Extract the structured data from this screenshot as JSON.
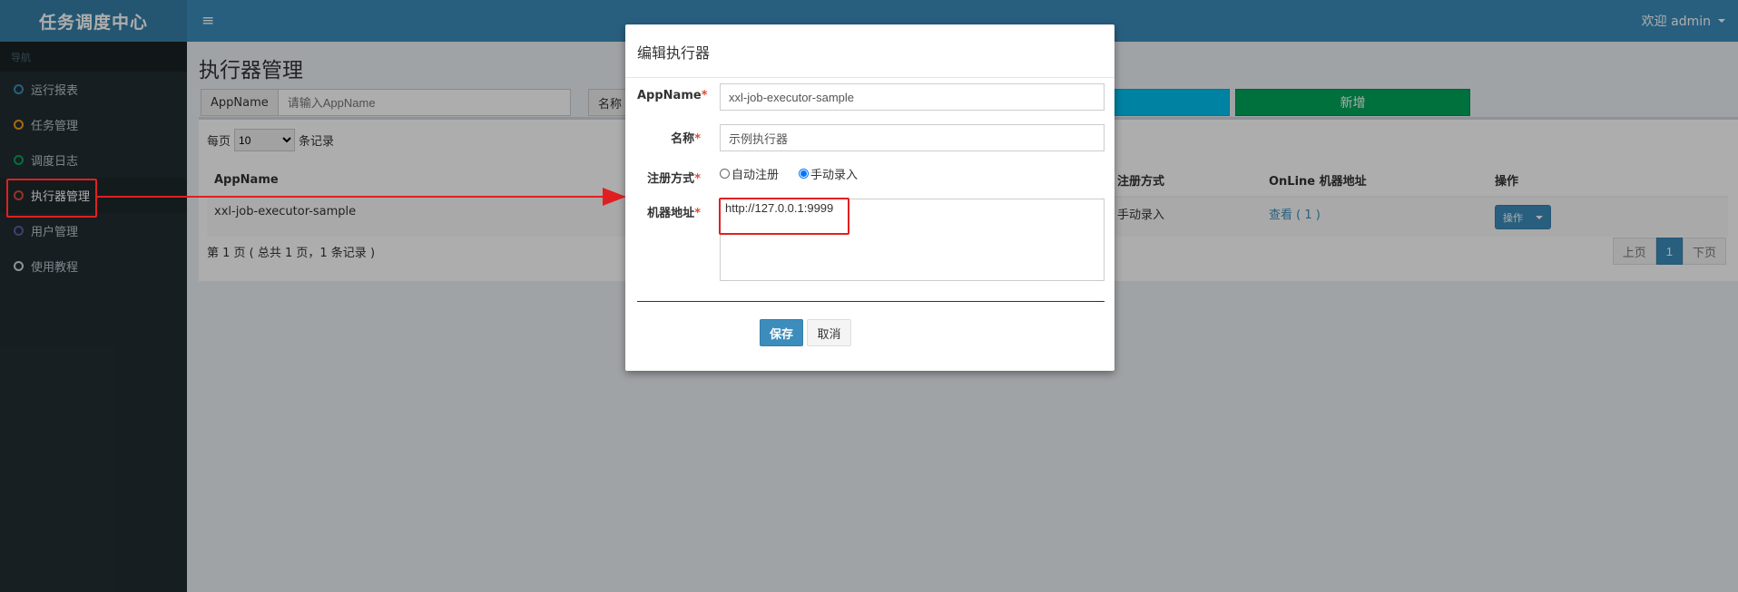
{
  "header": {
    "logo": "任务调度中心",
    "menu_icon": "≡",
    "user_label": "欢迎 admin"
  },
  "sidebar": {
    "section_label": "导航",
    "items": [
      {
        "label": "运行报表",
        "color": "#3c8dbc"
      },
      {
        "label": "任务管理",
        "color": "#f39c12"
      },
      {
        "label": "调度日志",
        "color": "#00a65a"
      },
      {
        "label": "执行器管理",
        "color": "#dd4b39"
      },
      {
        "label": "用户管理",
        "color": "#605ca8"
      },
      {
        "label": "使用教程",
        "color": "#d2d6de"
      }
    ]
  },
  "main": {
    "title": "执行器管理",
    "search": {
      "appname_label": "AppName",
      "appname_placeholder": "请输入AppName",
      "name_label": "名称"
    },
    "add_label": "新增",
    "page_size_prefix": "每页",
    "page_size_value": "10",
    "page_size_suffix": "条记录",
    "table": {
      "headers": [
        "AppName",
        "注册方式",
        "OnLine 机器地址",
        "操作"
      ],
      "rows": [
        {
          "appname": "xxl-job-executor-sample",
          "reg_type": "手动录入",
          "online": "查看 ( 1 )",
          "action": "操作"
        }
      ]
    },
    "pager_info": "第 1 页 ( 总共 1 页，1 条记录 )",
    "pager": {
      "prev": "上页",
      "current": "1",
      "next": "下页"
    }
  },
  "modal": {
    "title": "编辑执行器",
    "fields": {
      "appname_label": "AppName",
      "appname_value": "xxl-job-executor-sample",
      "name_label": "名称",
      "name_value": "示例执行器",
      "reg_label": "注册方式",
      "reg_auto": "自动注册",
      "reg_manual": "手动录入",
      "addr_label": "机器地址",
      "addr_value": "http://127.0.0.1:9999",
      "required_mark": "*"
    },
    "save_label": "保存",
    "cancel_label": "取消"
  },
  "colors": {
    "header_bg": "#3c8dbc",
    "logo_bg": "#367fa9",
    "sidebar_bg": "#222d32",
    "annotation_red": "#e02020"
  }
}
